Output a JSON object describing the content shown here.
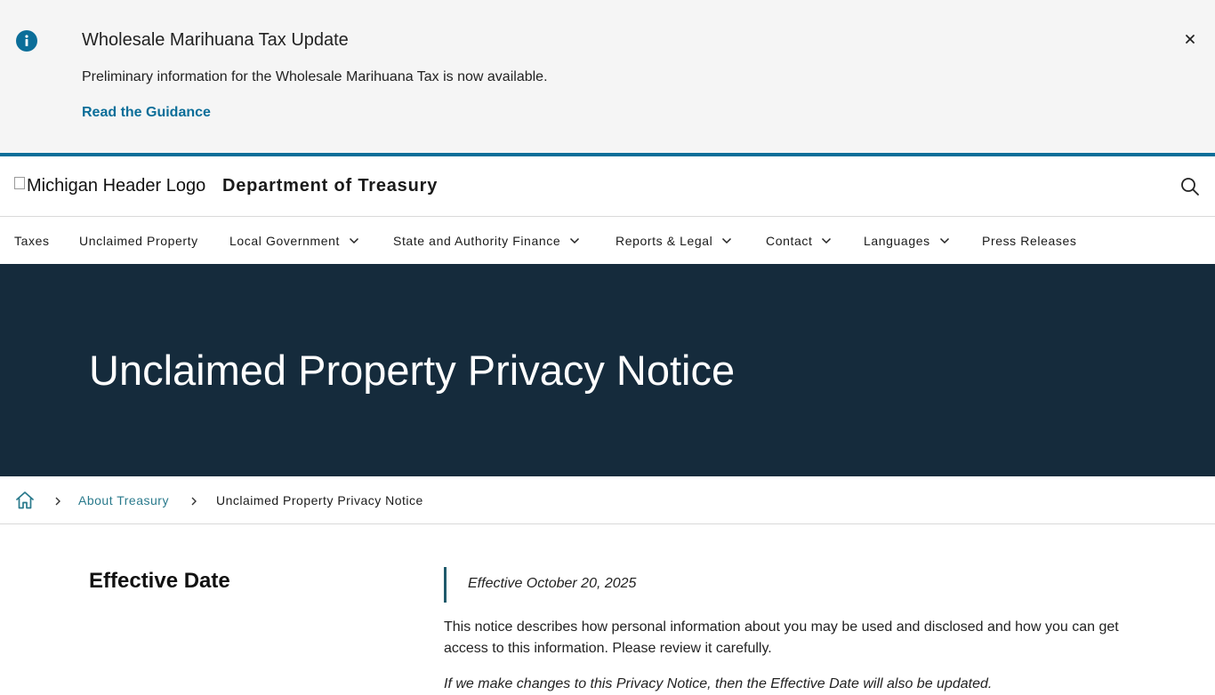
{
  "alert": {
    "title": "Wholesale Marihuana Tax Update",
    "text": "Preliminary information for the Wholesale Marihuana Tax is now available.",
    "link": "Read the Guidance",
    "icon": "info-icon",
    "close_icon": "close-icon"
  },
  "header": {
    "logo_alt": "Michigan Header Logo",
    "title": "Department of Treasury",
    "search_icon": "search-icon"
  },
  "nav": {
    "items": [
      {
        "label": "Taxes",
        "has_menu": false
      },
      {
        "label": "Unclaimed Property",
        "has_menu": false
      },
      {
        "label": "Local Government",
        "has_menu": true
      },
      {
        "label": "State and Authority Finance",
        "has_menu": true
      },
      {
        "label": "Reports & Legal",
        "has_menu": true
      },
      {
        "label": "Contact",
        "has_menu": true
      },
      {
        "label": "Languages",
        "has_menu": true
      },
      {
        "label": "Press Releases",
        "has_menu": false
      }
    ]
  },
  "hero": {
    "title": "Unclaimed Property Privacy Notice"
  },
  "breadcrumb": {
    "home_icon": "home-icon",
    "items": [
      "About Treasury",
      "Unclaimed Property Privacy Notice"
    ]
  },
  "content": {
    "heading": "Effective Date",
    "effective": "Effective October 20, 2025",
    "paragraph": "This notice describes how personal information about you may be used and disclosed and how you can get access to this information. Please review it carefully.",
    "paragraph2": "If we make changes to this Privacy Notice, then the Effective Date will also be updated."
  },
  "colors": {
    "accent": "#0b6e99",
    "hero_bg": "#152b3c",
    "alert_bg": "#f5f5f5"
  }
}
